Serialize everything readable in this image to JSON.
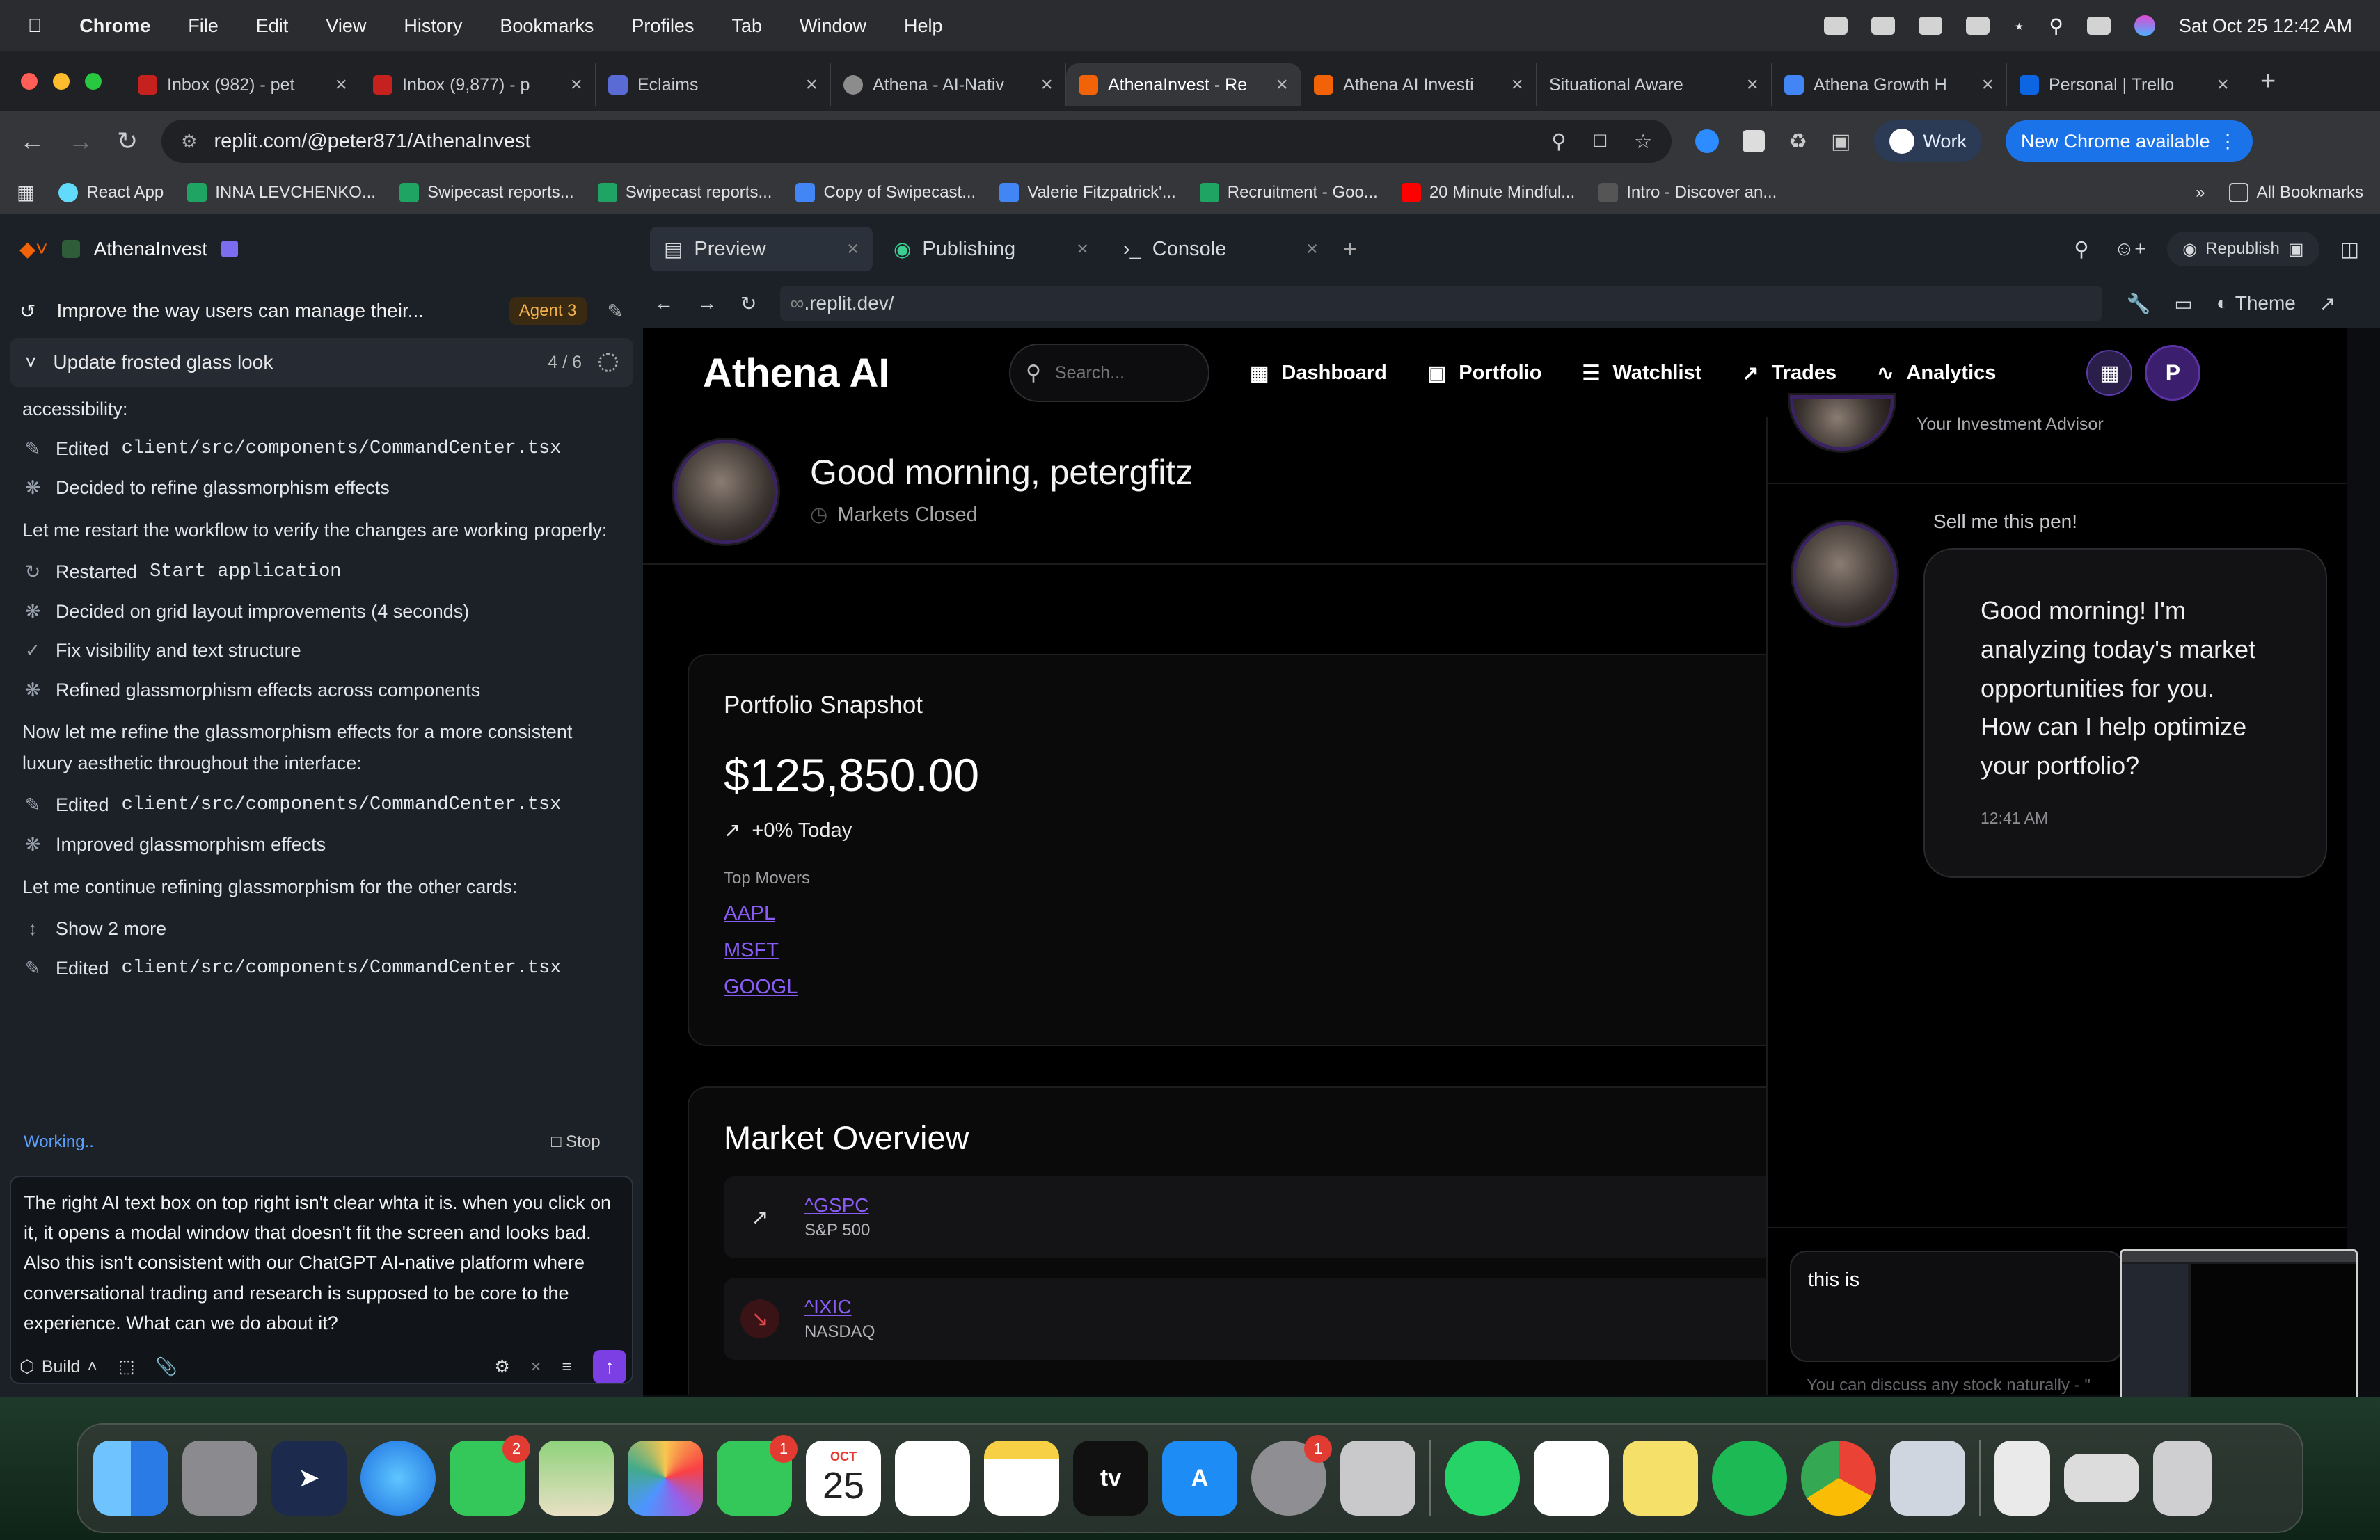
{
  "menubar": {
    "app": "Chrome",
    "items": [
      "File",
      "Edit",
      "View",
      "History",
      "Bookmarks",
      "Profiles",
      "Tab",
      "Window",
      "Help"
    ],
    "datetime": "Sat Oct 25  12:42 AM"
  },
  "tabs": [
    {
      "label": "Inbox (982) - pet",
      "color": "#c5221f"
    },
    {
      "label": "Inbox (9,877) - p",
      "color": "#c5221f"
    },
    {
      "label": "Eclaims",
      "color": "#5b6bd6"
    },
    {
      "label": "Athena - AI-Nativ",
      "color": "#8c8c8c"
    },
    {
      "label": "AthenaInvest - Re",
      "color": "#f26207"
    },
    {
      "label": "Athena AI Investi",
      "color": "#f26207"
    },
    {
      "label": "Situational Aware",
      "color": "#444"
    },
    {
      "label": "Athena Growth H",
      "color": "#4285f4"
    },
    {
      "label": "Personal | Trello",
      "color": "#0c66e4"
    }
  ],
  "omnibar": {
    "url": "replit.com/@peter871/AthenaInvest",
    "profile": "Work",
    "update": "New Chrome available"
  },
  "bookmarks": [
    {
      "label": "React App",
      "color": "#61dafb"
    },
    {
      "label": "INNA LEVCHENKO...",
      "color": "#1fa463"
    },
    {
      "label": "Swipecast reports...",
      "color": "#1fa463"
    },
    {
      "label": "Swipecast reports...",
      "color": "#1fa463"
    },
    {
      "label": "Copy of Swipecast...",
      "color": "#4285f4"
    },
    {
      "label": "Valerie Fitzpatrick'...",
      "color": "#4285f4"
    },
    {
      "label": "Recruitment - Goo...",
      "color": "#1fa463"
    },
    {
      "label": "20 Minute Mindful...",
      "color": "#ff0000"
    },
    {
      "label": "Intro - Discover an...",
      "color": "#555"
    }
  ],
  "bookmarks_all": "All Bookmarks",
  "replit": {
    "project": "AthenaInvest",
    "thread": "Improve the way users can manage their...",
    "agent": "Agent 3",
    "update": "Update frosted glass look",
    "progress": "4 / 6",
    "log": {
      "l0": "accessibility:",
      "l1a": "Edited",
      "l1b": "client/src/components/CommandCenter.tsx",
      "l2": "Decided to refine glassmorphism effects",
      "l3": "Let me restart the workflow to verify the changes are working properly:",
      "l4a": "Restarted",
      "l4b": "Start application",
      "l5": "Decided on grid layout improvements (4 seconds)",
      "l6": "Fix visibility and text structure",
      "l7": "Refined glassmorphism effects across components",
      "l8": "Now let me refine the glassmorphism effects for a more consistent luxury aesthetic throughout the interface:",
      "l9a": "Edited",
      "l9b": "client/src/components/CommandCenter.tsx",
      "l10": "Improved glassmorphism effects",
      "l11": "Let me continue refining glassmorphism for the other cards:",
      "l12": "Show 2 more",
      "l13a": "Edited",
      "l13b": "client/src/components/CommandCenter.tsx"
    },
    "working": "Working..",
    "stop": "Stop",
    "prompt": "The right AI text box on top right isn't clear whta it is. when you click on it, it opens a modal window that doesn't fit the screen and looks bad. Also this isn't consistent with our ChatGPT AI-native platform where conversational trading and research is supposed to be core to the experience. What can we do about it?",
    "build": "Build"
  },
  "rtabs": {
    "preview": "Preview",
    "publishing": "Publishing",
    "console": "Console",
    "republish": "Republish"
  },
  "preview_url": ".replit.dev/",
  "theme": "Theme",
  "app": {
    "brand": "Athena AI",
    "search_placeholder": "Search...",
    "nav": [
      "Dashboard",
      "Portfolio",
      "Watchlist",
      "Trades",
      "Analytics"
    ],
    "avatar_letter": "P",
    "greeting": "Good morning, petergfitz",
    "market_status": "Markets Closed",
    "snapshot": {
      "title": "Portfolio Snapshot",
      "value": "$125,850.00",
      "change": "+0% Today",
      "movers_label": "Top Movers",
      "movers": [
        "AAPL",
        "MSFT",
        "GOOGL"
      ]
    },
    "overview": {
      "title": "Market Overview",
      "rows": [
        {
          "symbol": "^GSPC",
          "name": "S&P 500"
        },
        {
          "symbol": "^IXIC",
          "name": "NASDAQ"
        }
      ]
    },
    "chat": {
      "advisor": "Your Investment Advisor",
      "user_msg": "Sell me this pen!",
      "bot_msg": "Good morning! I'm analyzing today's market opportunities for you. How can I help optimize your portfolio?",
      "bot_time": "12:41 AM",
      "input": "this is",
      "hint": "You can discuss any stock naturally - \""
    }
  },
  "dock": {
    "calendar_month": "OCT",
    "calendar_day": "25",
    "messages_badge": "2",
    "facetime_badge": "1",
    "settings_badge": "1",
    "tv": "tv"
  }
}
